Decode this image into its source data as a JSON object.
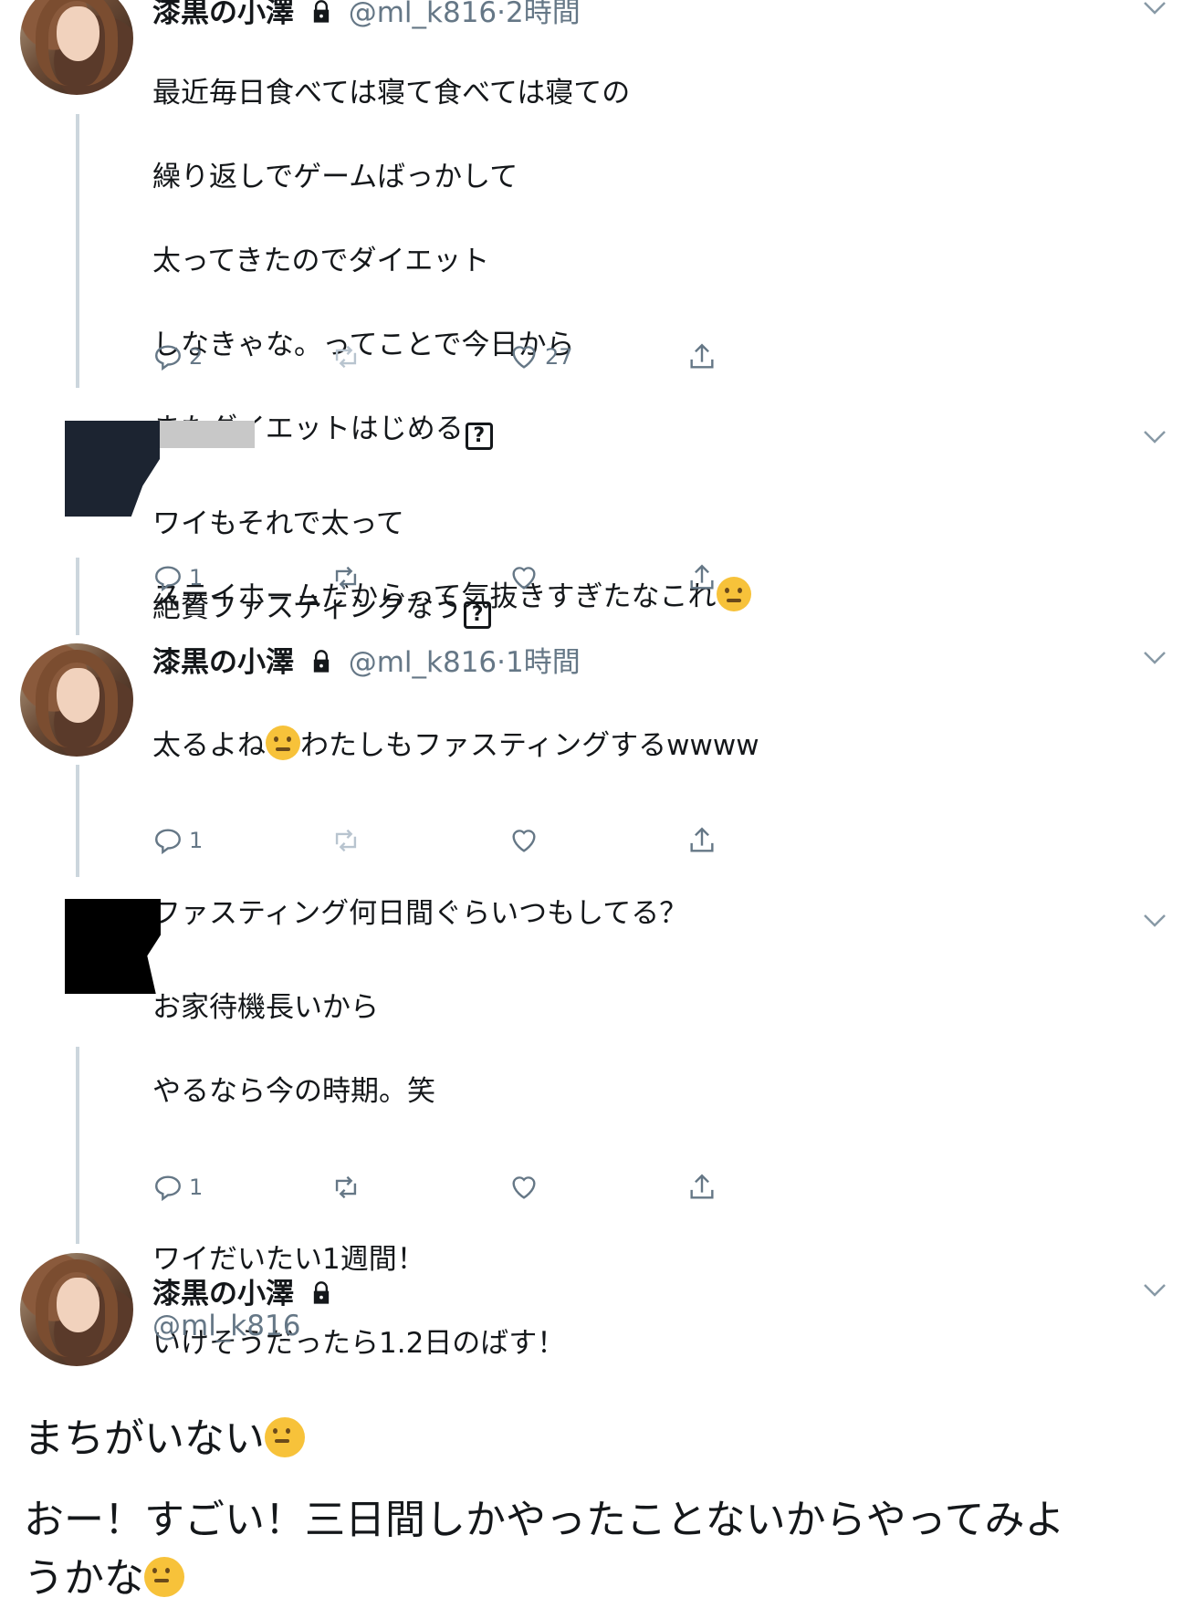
{
  "tweet1": {
    "name": "漆黒の小澤",
    "handle": "@ml_k816",
    "time": "·2時間",
    "lines": [
      "最近毎日食べては寝て食べては寝ての",
      "繰り返しでゲームばっかして",
      "太ってきたのでダイエット",
      "しなきゃな。ってことで今日から",
      "またダイエットはじめる"
    ],
    "line2": "ステイホームだからって気抜きすぎたなこれ",
    "replies": "2",
    "likes": "27"
  },
  "tweet2": {
    "lines": [
      "ワイもそれで太って",
      "絶賛ファスティングなう"
    ],
    "replies": "1"
  },
  "tweet3": {
    "name": "漆黒の小澤",
    "handle": "@ml_k816",
    "time": "·1時間",
    "line1a": "太るよね",
    "line1b": "わたしもファスティングするwwww",
    "line2": "ファスティング何日間ぐらいつもしてる？",
    "replies": "1"
  },
  "tweet4": {
    "lines": [
      "お家待機長いから",
      "やるなら今の時期。笑",
      "",
      "ワイだいたい1週間！",
      "いけそうだったら1.2日のばす！"
    ],
    "replies": "1"
  },
  "tweet5": {
    "name": "漆黒の小澤",
    "handle": "@ml_k816"
  },
  "comment": {
    "line1": "まちがいない",
    "line2a": "おー！すごい！三日間しかやったことないからやってみよ",
    "line2b": "うかな"
  }
}
